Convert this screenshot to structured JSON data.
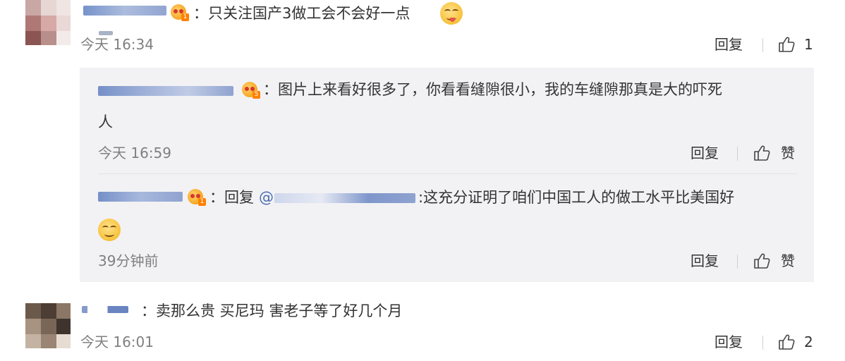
{
  "comments": [
    {
      "text": "：只关注国产3做工会不会好一点",
      "time": "今天 16:34",
      "reply_label": "回复",
      "like_count": "1"
    },
    {
      "text": "：卖那么贵 买尼玛 害老子等了好几个月",
      "time": "今天 16:01",
      "reply_label": "回复",
      "like_count": "2"
    }
  ],
  "replies": [
    {
      "text_line1": "：图片上来看好很多了，你看看缝隙很小，我的车缝隙那真是大的吓死",
      "text_line2": "人",
      "time": "今天 16:59",
      "reply_label": "回复",
      "like_label": "赞"
    },
    {
      "text_prefix": "：回复",
      "at_symbol": "@",
      "text_rest": ":这充分证明了咱们中国工人的做工水平比美国好",
      "time": "39分钟前",
      "reply_label": "回复",
      "like_label": "赞"
    }
  ],
  "icons": {
    "badge": "vip-crown-icon",
    "like": "thumbs-up-icon",
    "emoji_yum": "yum-face-emoji",
    "emoji_smile": "smirk-face-emoji"
  },
  "colors": {
    "reply_bg": "#f2f2f5",
    "muted_text": "#808080",
    "badge_orange": "#ff8200"
  }
}
